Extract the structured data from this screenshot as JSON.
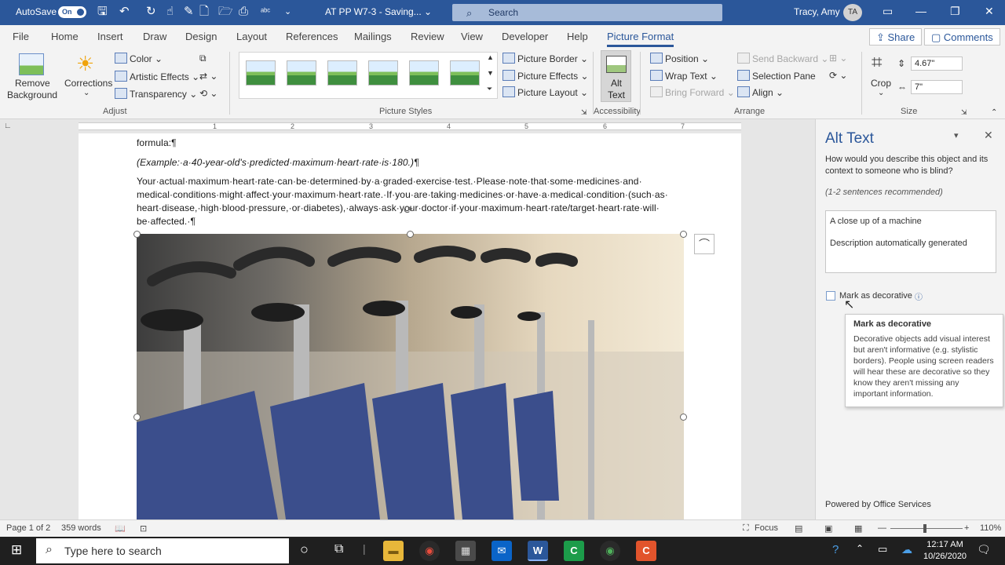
{
  "titlebar": {
    "autosave_label": "AutoSave",
    "autosave_state": "On",
    "doc_title": "AT PP W7-3 -  Saving... ⌄",
    "search_placeholder": "Search",
    "user_name": "Tracy, Amy",
    "user_initials": "TA"
  },
  "tabs": [
    "File",
    "Home",
    "Insert",
    "Draw",
    "Design",
    "Layout",
    "References",
    "Mailings",
    "Review",
    "View",
    "Developer",
    "Help",
    "Picture Format"
  ],
  "share_label": "Share",
  "comments_label": "Comments",
  "ribbon": {
    "remove_bg": [
      "Remove",
      "Background"
    ],
    "corrections": "Corrections",
    "color": "Color",
    "artistic_effects": "Artistic Effects",
    "transparency": "Transparency",
    "adjust_label": "Adjust",
    "picture_styles_label": "Picture Styles",
    "picture_border": "Picture Border",
    "picture_effects": "Picture Effects",
    "picture_layout": "Picture Layout",
    "alt_text": [
      "Alt",
      "Text"
    ],
    "accessibility_label": "Accessibility",
    "position": "Position",
    "wrap_text": "Wrap Text",
    "bring_forward": "Bring Forward",
    "send_backward": "Send Backward",
    "selection_pane": "Selection Pane",
    "align": "Align",
    "arrange_label": "Arrange",
    "crop": "Crop",
    "height": "4.67\"",
    "width": "7\"",
    "size_label": "Size"
  },
  "ruler_numbers": [
    "1",
    "2",
    "3",
    "4",
    "5",
    "6",
    "7"
  ],
  "document": {
    "line1": "formula:¶",
    "line2": "(Example:·a·40-year-old's·predicted·maximum·heart·rate·is·180.)¶",
    "para3": [
      "Your·actual·maximum·heart·rate·can·be·determined·by·a·graded·exercise·test.·Please·note·that·some·medicines·and·",
      "medical·conditions·might·affect·your·maximum·heart·rate.·If·you·are·taking·medicines·or·have·a·medical·condition·(such·as·",
      "heart·disease,·high·blood·pressure,·or·diabetes),·always·ask·your·doctor·if·your·maximum·heart·rate/target·heart·rate·will·",
      "be·affected.·¶"
    ]
  },
  "alt_pane": {
    "title": "Alt Text",
    "question": [
      "How would you describe this object and its",
      "context to someone who is blind?"
    ],
    "hint": "(1-2 sentences recommended)",
    "value_line1": "A close up of a machine",
    "value_line2": "Description automatically generated",
    "decorative_label": "Mark as decorative",
    "powered_by": "Powered by Office Services"
  },
  "tooltip": {
    "title": "Mark as decorative",
    "body": "Decorative objects add visual interest but aren't informative (e.g. stylistic borders). People using screen readers will hear these are decorative so they know they aren't missing any important information."
  },
  "statusbar": {
    "page": "Page 1 of 2",
    "words": "359 words",
    "focus": "Focus",
    "zoom": "110%"
  },
  "taskbar": {
    "search_placeholder": "Type here to search",
    "time": "12:17 AM",
    "date": "10/26/2020"
  }
}
